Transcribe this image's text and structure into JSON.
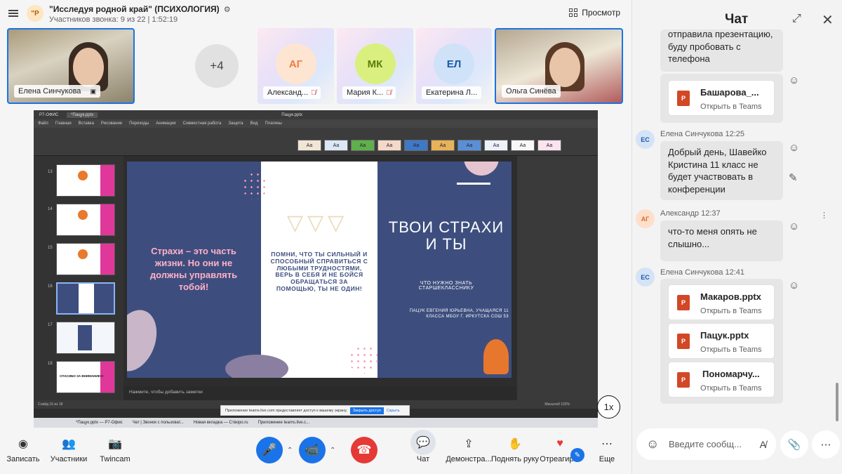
{
  "call": {
    "avatar_initials": "\"Р",
    "title": "\"Исследуя родной край\" (ПСИХОЛОГИЯ)",
    "subtitle": "Участников звонка: 9 из 22 | 1:52:19",
    "view_label": "Просмотр"
  },
  "participants": [
    {
      "name": "Елена Синчукова",
      "type": "camera"
    },
    {
      "more": "+4"
    },
    {
      "initials": "АГ",
      "name": "Александ...",
      "color": "#f07b3f",
      "bg": "#fde5d2"
    },
    {
      "initials": "МК",
      "name": "Мария К...",
      "color": "#5c7d0b",
      "bg": "#d9f07f"
    },
    {
      "initials": "ЕЛ",
      "name": "Екатерина Л...",
      "color": "#1a5aa8",
      "bg": "#cfe2f8"
    },
    {
      "name": "Ольга Синёва",
      "type": "camera"
    }
  ],
  "screen_share": {
    "app_name": "Р7-ОФИС",
    "doc_tab": "*Пацук.pptx",
    "file_title": "Пацук.pptx",
    "ribbon_tabs": [
      "Файл",
      "Главная",
      "Вставка",
      "Рисование",
      "Переходы",
      "Анимация",
      "Совместная работа",
      "Защита",
      "Вид",
      "Плагины"
    ],
    "theme_label": "Аа",
    "slide_numbers": [
      "13",
      "14",
      "15",
      "16",
      "17",
      "18"
    ],
    "thumb_last_text": "СПАСИБО ЗА ВНИМАНИЕ!!!",
    "slide": {
      "left_text": "Страхи – это часть жизни. Но они не должны управлять тобой!",
      "mid_text": "ПОМНИ, ЧТО ТЫ СИЛЬНЫЙ И СПОСОБНЫЙ СПРАВИТЬСЯ С ЛЮБЫМИ ТРУДНОСТЯМИ, ВЕРЬ В СЕБЯ И НЕ БОЙСЯ ОБРАЩАТЬСЯ ЗА ПОМОЩЬЮ, ТЫ НЕ ОДИН!",
      "title": "ТВОИ СТРАХИ И ТЫ",
      "subtitle": "ЧТО НУЖНО ЗНАТЬ СТАРШЕКЛАССНИКУ",
      "author": "ПАЦУК ЕВГЕНИЯ ЮРЬЕВНА, УЧАЩАЯСЯ 11 КЛАССА МБОУ Г. ИРКУТСКА СОШ 53"
    },
    "notes_placeholder": "Нажмите, чтобы добавить заметки",
    "status": "Слайд 16 из 18",
    "zoom": "Масштаб 102%",
    "teams_notice": "Приложение teams.live.com предоставляет доступ к вашему экрану.",
    "teams_stop": "Закрыть доступ",
    "teams_hide": "Скрыть",
    "taskbar": [
      "*Пацук.pptx — Р7-Офис",
      "Чат | Звонок с пользоват...",
      "Новая вкладка — Створо.ru",
      "Приложение teams.live.c..."
    ],
    "playback_speed": "1x"
  },
  "toolbar": {
    "record": "Записать",
    "participants": "Участники",
    "twincam": "Twincam",
    "chat": "Чат",
    "share": "Демонстра...",
    "raise_hand": "Поднять руку",
    "react": "Отреагир...",
    "more": "Еще"
  },
  "chat": {
    "title": "Чат",
    "messages": [
      {
        "text": "отправила презентацию, буду пробовать с телефона"
      },
      {
        "file": "Башарова_...",
        "open": "Открыть в Teams"
      },
      {
        "initials": "ЕС",
        "author": "Елена Синчукова 12:25",
        "text": "Добрый день, Шавейко Кристина 11 класс не будет участвовать в конференции"
      },
      {
        "initials": "АГ",
        "author": "Александр 12:37",
        "text": "что-то меня опять не слышно..."
      },
      {
        "initials": "ЕС",
        "author": "Елена Синчукова 12:41"
      },
      {
        "file": "Макаров.pptx",
        "open": "Открыть в Teams"
      },
      {
        "file": "Пацук.pptx",
        "open": "Открыть в Teams"
      },
      {
        "file": "Пономарчу...",
        "open": "Открыть в Teams"
      }
    ],
    "input_placeholder": "Введите сообщ..."
  },
  "colors": {
    "accent": "#1a73e8",
    "end_call": "#e53935",
    "slide_bg": "#3d4e7e"
  }
}
